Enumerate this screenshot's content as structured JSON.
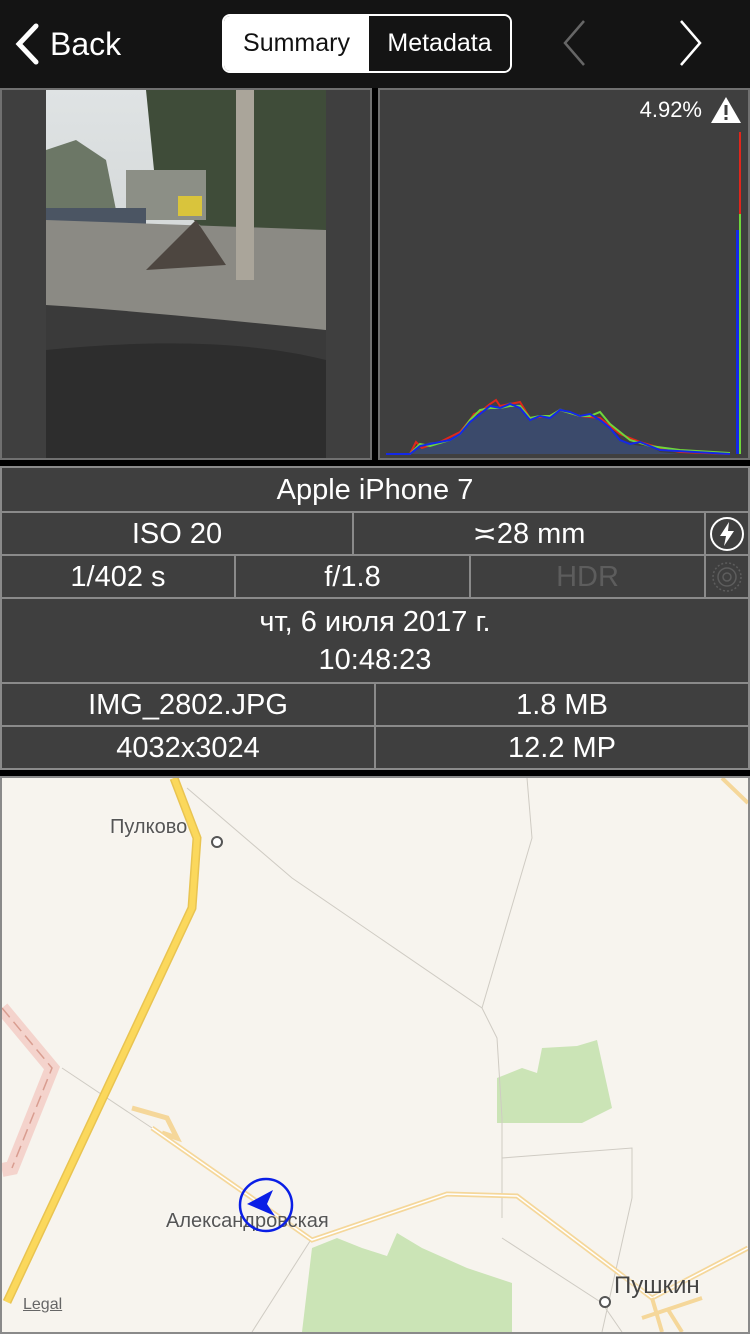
{
  "header": {
    "back_label": "Back",
    "tabs": [
      {
        "label": "Summary",
        "selected": true
      },
      {
        "label": "Metadata",
        "selected": false
      }
    ],
    "prev_enabled": false,
    "next_enabled": true
  },
  "histogram": {
    "clipping_percent": "4.92%",
    "warning_icon": "warning-triangle-icon",
    "colors": {
      "red": "#e0261b",
      "green": "#6fd63a",
      "blue": "#1428e6",
      "fill": "#3b4a6b"
    }
  },
  "info": {
    "camera": "Apple iPhone 7",
    "iso": "ISO 20",
    "focal_length": "≍28 mm",
    "flash_icon": "flash-icon",
    "shutter": "1/402 s",
    "aperture": "f/1.8",
    "hdr": "HDR",
    "live_icon": "live-photo-icon",
    "date": "чт, 6 июля 2017 г.",
    "time": "10:48:23",
    "filename": "IMG_2802.JPG",
    "filesize": "1.8 MB",
    "resolution": "4032x3024",
    "megapixels": "12.2 MP"
  },
  "map": {
    "labels": {
      "pulkovo": "Пулково",
      "aleksandrovskaya": "Александровская",
      "pushkin": "Пушкин"
    },
    "legal": "Legal",
    "marker_color": "#0a1ee6"
  }
}
